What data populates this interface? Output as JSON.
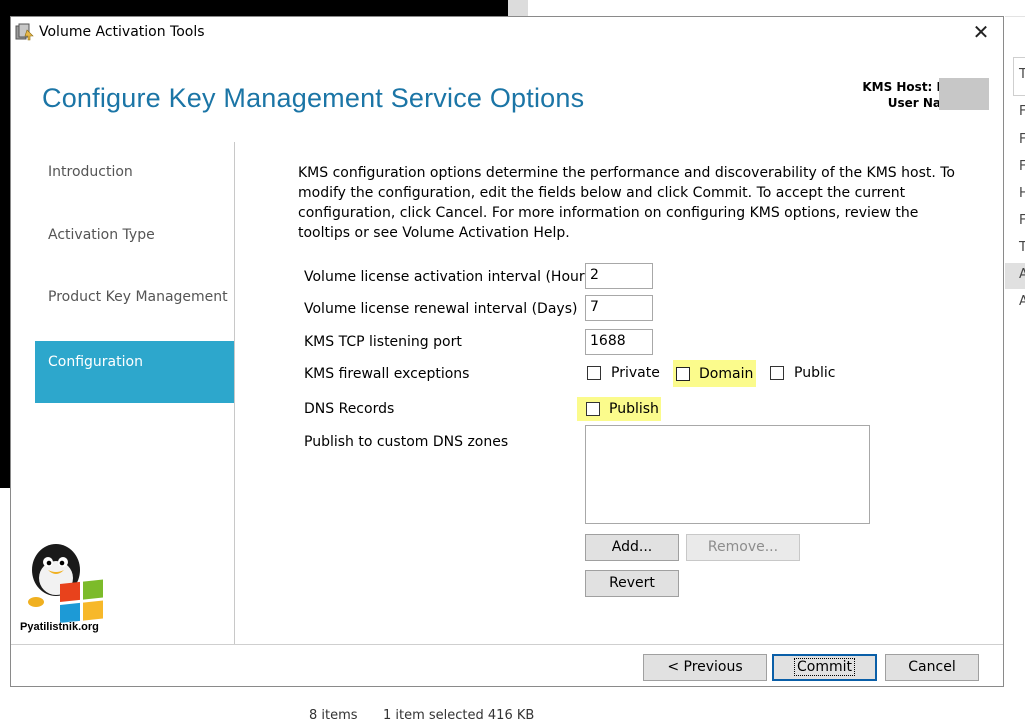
{
  "window": {
    "title": "Volume Activation Tools",
    "close_glyph": "✕"
  },
  "page": {
    "title": "Configure Key Management Service Options"
  },
  "host": {
    "kms_host_label": "KMS Host: I",
    "user_name_label": "User Na"
  },
  "nav": {
    "items": [
      {
        "label": "Introduction"
      },
      {
        "label": "Activation Type"
      },
      {
        "label": "Product Key Management"
      },
      {
        "label": "Configuration"
      }
    ]
  },
  "description": "KMS configuration options determine the performance and discoverability of the KMS host. To modify the configuration, edit the fields below and click Commit. To accept the current configuration, click Cancel. For more information on configuring KMS options, review the tooltips or see Volume Activation Help.",
  "fields": {
    "activation_interval": {
      "label": "Volume license activation interval (Hours)",
      "value": "2"
    },
    "renewal_interval": {
      "label": "Volume license renewal interval (Days)",
      "value": "7"
    },
    "tcp_port": {
      "label": "KMS TCP listening port",
      "value": "1688"
    },
    "firewall": {
      "label": "KMS firewall exceptions",
      "private": "Private",
      "domain": "Domain",
      "public": "Public"
    },
    "dns_records": {
      "label": "DNS Records",
      "publish": "Publish"
    },
    "custom_zones": {
      "label": "Publish to custom DNS zones"
    }
  },
  "buttons": {
    "add": "Add...",
    "remove": "Remove...",
    "revert": "Revert",
    "previous": "< Previous",
    "commit": "Commit",
    "cancel": "Cancel"
  },
  "logo": {
    "text": "Pyatilistnik.org"
  },
  "background": {
    "status_items": "8 items",
    "status_selected": "1 item selected  416 KB",
    "explorer_letters": [
      "T",
      "F",
      "F",
      "F",
      "H",
      "F",
      "T",
      "A",
      "A"
    ]
  },
  "colors": {
    "accent": "#1b75a6",
    "nav_active": "#2da7cc",
    "highlight": "#fbfb8c"
  }
}
